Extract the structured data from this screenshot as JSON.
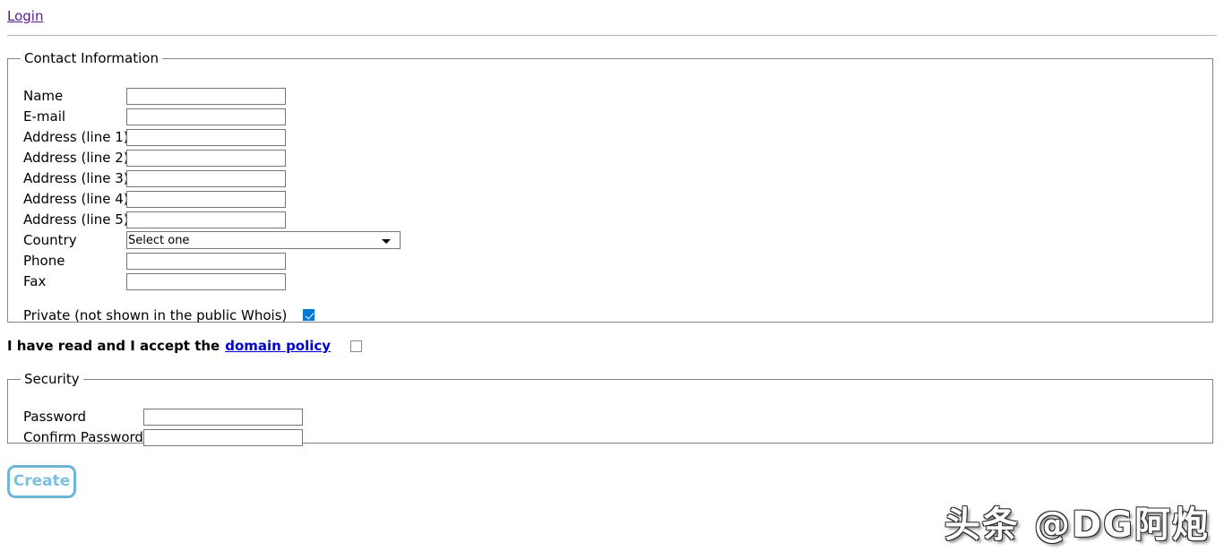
{
  "topbar": {
    "login_label": "Login"
  },
  "contact": {
    "legend": "Contact Information",
    "fields": [
      {
        "label": "Name",
        "value": "",
        "placeholder": "",
        "type": "text"
      },
      {
        "label": "E-mail",
        "value": "",
        "placeholder": "",
        "type": "text"
      },
      {
        "label": "Address (line 1)",
        "value": "",
        "placeholder": "",
        "type": "text"
      },
      {
        "label": "Address (line 2)",
        "value": "",
        "placeholder": "",
        "type": "text"
      },
      {
        "label": "Address (line 3)",
        "value": "",
        "placeholder": "",
        "type": "text"
      },
      {
        "label": "Address (line 4)",
        "value": "",
        "placeholder": "",
        "type": "text"
      },
      {
        "label": "Address (line 5)",
        "value": "",
        "placeholder": "",
        "type": "text"
      },
      {
        "label": "Country",
        "value": "Select one",
        "placeholder": "",
        "type": "select"
      },
      {
        "label": "Phone",
        "value": "",
        "placeholder": "",
        "type": "text"
      },
      {
        "label": "Fax",
        "value": "",
        "placeholder": "",
        "type": "text"
      }
    ],
    "country_selected": "Select one",
    "private": {
      "label": "Private (not shown in the public Whois)",
      "checked": true
    }
  },
  "accept": {
    "text": "I have read and I accept the",
    "link_label": "domain policy",
    "checked": false
  },
  "security": {
    "legend": "Security",
    "fields": [
      {
        "label": "Password",
        "value": "",
        "placeholder": ""
      },
      {
        "label": "Confirm Password",
        "value": "",
        "placeholder": ""
      }
    ]
  },
  "actions": {
    "create_label": "Create"
  },
  "watermark": {
    "text": "头条 @DG阿炮"
  },
  "colors": {
    "login_link": "#551a8b",
    "policy_link": "#0000cc",
    "checkbox_checked": "#0078d7",
    "create_border": "#6cb6da",
    "create_text": "#7dc0e0",
    "fieldset_border": "#848484",
    "input_border": "#767676"
  }
}
